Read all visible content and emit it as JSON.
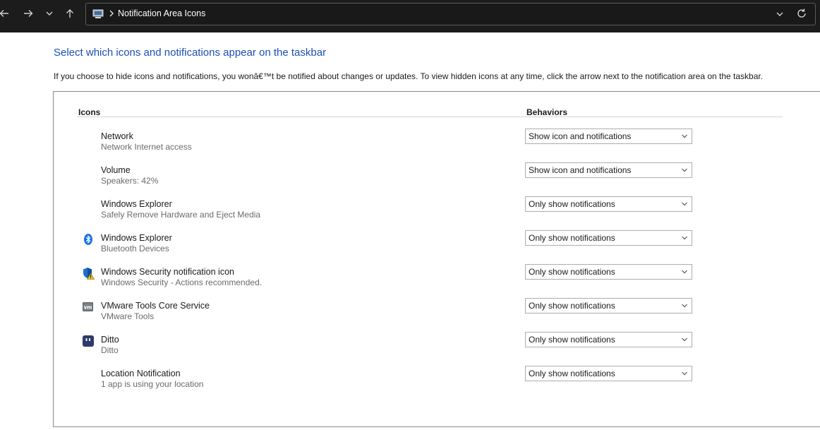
{
  "address_bar": {
    "location": "Notification Area Icons"
  },
  "page": {
    "heading": "Select which icons and notifications appear on the taskbar",
    "description": "If you choose to hide icons and notifications, you wonâ€™t be notified about changes or updates. To view hidden icons at any time, click the arrow next to the notification area on the taskbar."
  },
  "table": {
    "col_icons": "Icons",
    "col_behaviors": "Behaviors",
    "rows": [
      {
        "name": "Network",
        "sub": "Network Internet access",
        "behavior": "Show icon and notifications",
        "icon": "none"
      },
      {
        "name": "Volume",
        "sub": "Speakers: 42%",
        "behavior": "Show icon and notifications",
        "icon": "none"
      },
      {
        "name": "Windows Explorer",
        "sub": "Safely Remove Hardware and Eject Media",
        "behavior": "Only show notifications",
        "icon": "none"
      },
      {
        "name": "Windows Explorer",
        "sub": "Bluetooth Devices",
        "behavior": "Only show notifications",
        "icon": "bluetooth-icon"
      },
      {
        "name": "Windows Security notification icon",
        "sub": "Windows Security - Actions recommended.",
        "behavior": "Only show notifications",
        "icon": "windows-security-warning-icon"
      },
      {
        "name": "VMware Tools Core Service",
        "sub": "VMware Tools",
        "behavior": "Only show notifications",
        "icon": "vmware-icon"
      },
      {
        "name": "Ditto",
        "sub": "Ditto",
        "behavior": "Only show notifications",
        "icon": "ditto-icon"
      },
      {
        "name": "Location Notification",
        "sub": "1 app is using your location",
        "behavior": "Only show notifications",
        "icon": "none"
      }
    ]
  },
  "colors": {
    "topbar_bg": "#1c1c1c",
    "heading": "#1b4fb3",
    "bluetooth": "#1a73e8",
    "ditto": "#2e3a6b"
  }
}
